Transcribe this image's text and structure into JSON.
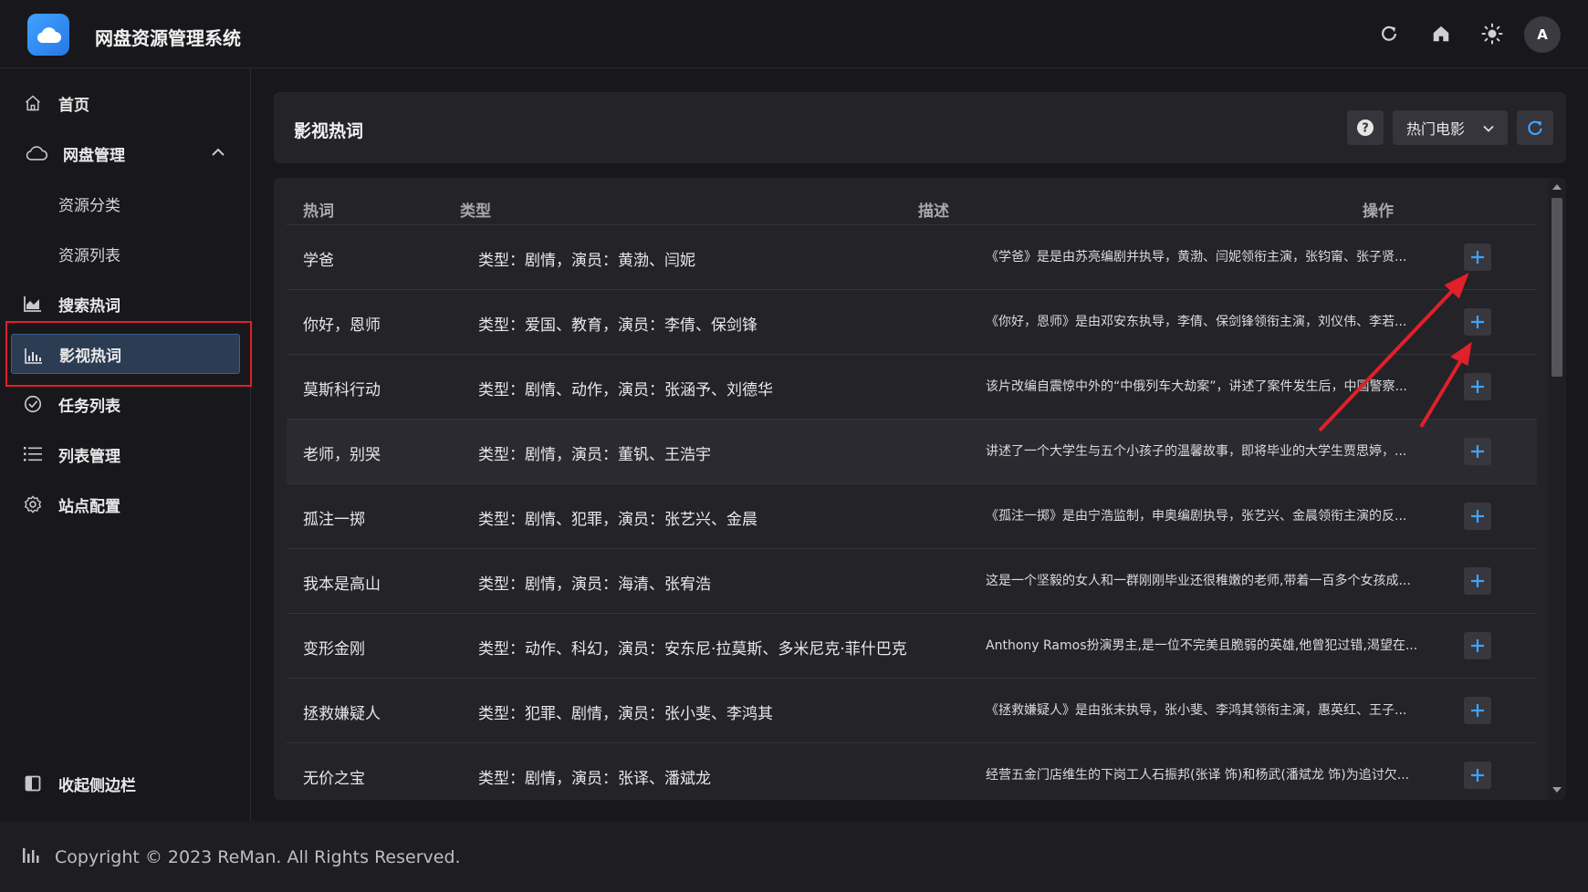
{
  "app": {
    "title": "网盘资源管理系统",
    "avatar_initial": "A",
    "accent_color": "#3fa3ff"
  },
  "topbar_icons": [
    "refresh-icon",
    "home-icon",
    "sun-icon"
  ],
  "sidebar": {
    "items": [
      {
        "label": "首页",
        "icon": "home-icon"
      },
      {
        "label": "网盘管理",
        "icon": "cloud-icon"
      },
      {
        "label": "资源分类",
        "icon": ""
      },
      {
        "label": "资源列表",
        "icon": ""
      },
      {
        "label": "搜索热词",
        "icon": "area-chart-icon"
      },
      {
        "label": "影视热词",
        "icon": "bar-chart-icon"
      },
      {
        "label": "任务列表",
        "icon": "check-circle-icon"
      },
      {
        "label": "列表管理",
        "icon": "list-icon"
      },
      {
        "label": "站点配置",
        "icon": "gear-icon"
      }
    ],
    "collapse_label": "收起侧边栏"
  },
  "page": {
    "title": "影视热词",
    "category_select": "热门电影"
  },
  "table": {
    "columns": [
      "热词",
      "类型",
      "描述",
      "操作"
    ],
    "rows": [
      {
        "word": "学爸",
        "type": "类型：剧情，演员：黄渤、闫妮",
        "desc": "《学爸》是是由苏亮编剧并执导，黄渤、闫妮领衔主演，张钧甯、张子贤..."
      },
      {
        "word": "你好，恩师",
        "type": "类型：爱国、教育，演员：李倩、保剑锋",
        "desc": "《你好，恩师》是由邓安东执导，李倩、保剑锋领衔主演，刘仪伟、李若..."
      },
      {
        "word": "莫斯科行动",
        "type": "类型：剧情、动作，演员：张涵予、刘德华",
        "desc": "该片改编自震惊中外的“中俄列车大劫案”，讲述了案件发生后，中国警察..."
      },
      {
        "word": "老师，别哭",
        "type": "类型：剧情，演员：董钒、王浩宇",
        "desc": "讲述了一个大学生与五个小孩子的温馨故事，即将毕业的大学生贾思婷，..."
      },
      {
        "word": "孤注一掷",
        "type": "类型：剧情、犯罪，演员：张艺兴、金晨",
        "desc": "《孤注一掷》是由宁浩监制，申奥编剧执导，张艺兴、金晨领衔主演的反..."
      },
      {
        "word": "我本是高山",
        "type": "类型：剧情，演员：海清、张宥浩",
        "desc": "这是一个坚毅的女人和一群刚刚毕业还很稚嫩的老师,带着一百多个女孩成..."
      },
      {
        "word": "变形金刚",
        "type": "类型：动作、科幻，演员：安东尼·拉莫斯、多米尼克·菲什巴克",
        "desc": "Anthony Ramos扮演男主,是一位不完美且脆弱的英雄,他曾犯过错,渴望在..."
      },
      {
        "word": "拯救嫌疑人",
        "type": "类型：犯罪、剧情，演员：张小斐、李鸿其",
        "desc": "《拯救嫌疑人》是由张末执导，张小斐、李鸿其领衔主演，惠英红、王子..."
      },
      {
        "word": "无价之宝",
        "type": "类型：剧情，演员：张译、潘斌龙",
        "desc": "经营五金门店维生的下岗工人石振邦(张译 饰)和杨武(潘斌龙 饰)为追讨欠..."
      }
    ]
  },
  "footer": {
    "copyright": "Copyright © 2023 ReMan. All Rights Reserved."
  }
}
